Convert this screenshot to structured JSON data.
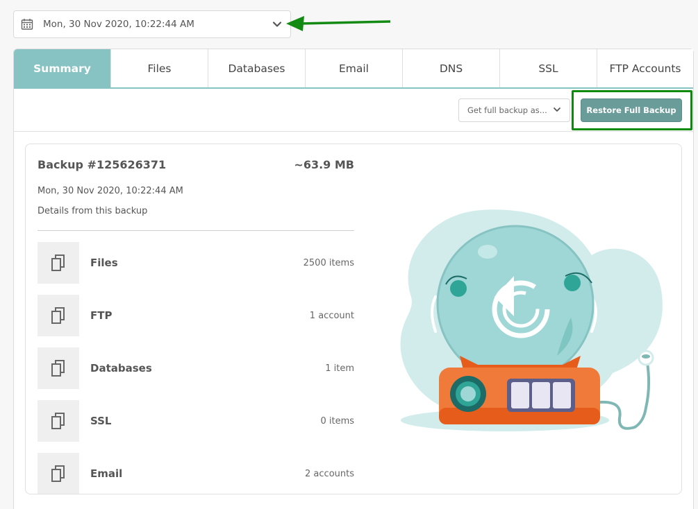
{
  "date_select": {
    "value": "Mon, 30 Nov 2020, 10:22:44 AM"
  },
  "tabs": [
    {
      "label": "Summary"
    },
    {
      "label": "Files"
    },
    {
      "label": "Databases"
    },
    {
      "label": "Email"
    },
    {
      "label": "DNS"
    },
    {
      "label": "SSL"
    },
    {
      "label": "FTP Accounts"
    }
  ],
  "toolbar": {
    "download_select": "Get full backup as...",
    "restore_label": "Restore Full Backup"
  },
  "backup": {
    "title": "Backup #125626371",
    "size": "~63.9 MB",
    "date": "Mon, 30 Nov 2020, 10:22:44 AM",
    "details": "Details from this backup",
    "items": [
      {
        "name": "Files",
        "count": "2500 items"
      },
      {
        "name": "FTP",
        "count": "1 account"
      },
      {
        "name": "Databases",
        "count": "1 item"
      },
      {
        "name": "SSL",
        "count": "0 items"
      },
      {
        "name": "Email",
        "count": "2 accounts"
      }
    ]
  },
  "colors": {
    "accent": "#86c3c2",
    "button": "#6a9c9a",
    "highlight": "#0c8a0c",
    "arrow": "#138a13"
  },
  "icons": {
    "date": "calendar-icon",
    "dropdown": "chevron-down-icon",
    "item": "copy-icon"
  }
}
